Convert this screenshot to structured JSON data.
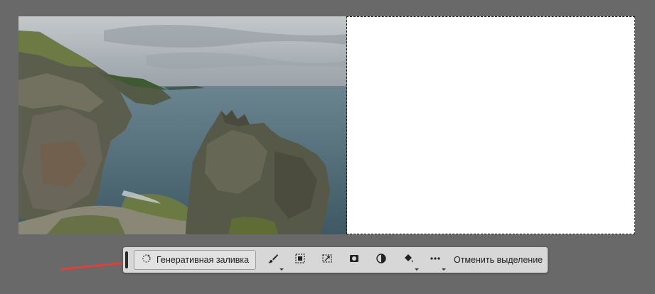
{
  "canvas": {
    "photo_description_icon": "landscape-photo",
    "blank_fill": "#ffffff"
  },
  "contextual_taskbar": {
    "generative_fill_label": "Генеративная заливка",
    "generative_fill_icon": "generative-fill-icon",
    "tools": [
      {
        "name": "brush-icon",
        "has_submenu": true
      },
      {
        "name": "select-subject-icon",
        "has_submenu": false
      },
      {
        "name": "transform-selection-icon",
        "has_submenu": false
      },
      {
        "name": "mask-icon",
        "has_submenu": false
      },
      {
        "name": "adjustment-icon",
        "has_submenu": false
      },
      {
        "name": "fill-bucket-icon",
        "has_submenu": true
      },
      {
        "name": "more-options-icon",
        "has_submenu": true
      }
    ],
    "deselect_label": "Отменить выделение"
  },
  "annotation": {
    "arrow_color": "#e0403a"
  }
}
